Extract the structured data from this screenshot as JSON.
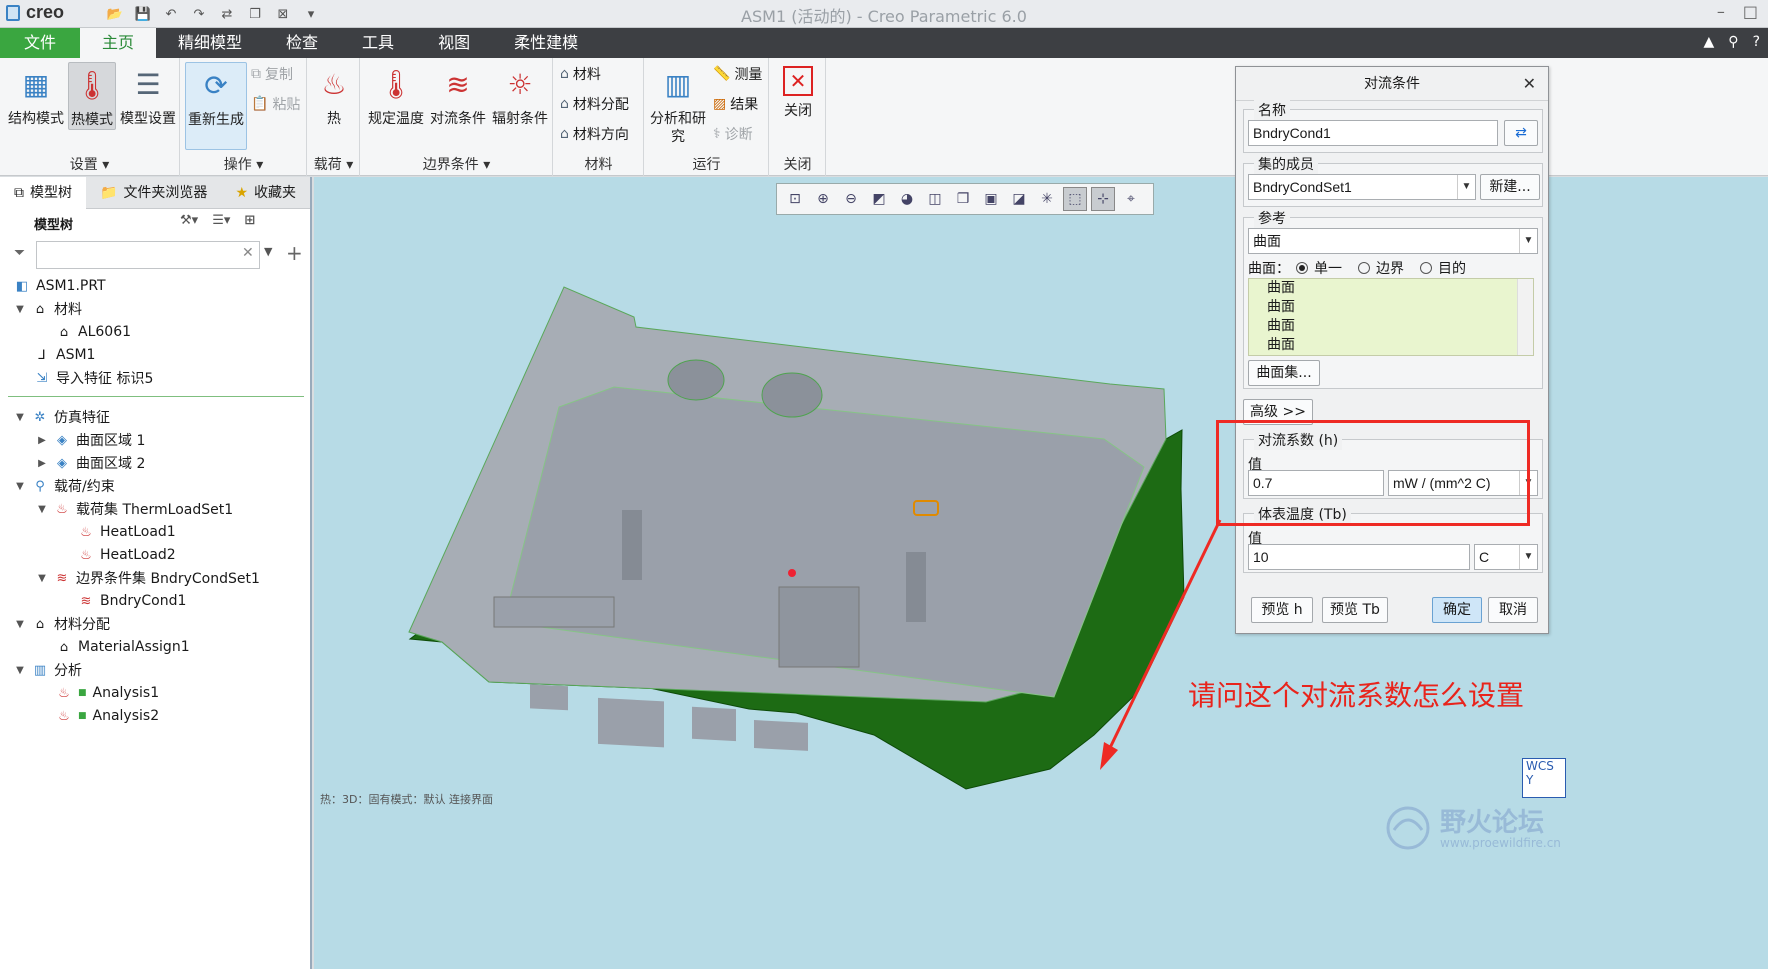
{
  "app": {
    "logo": "creo",
    "window_title": "ASM1 (活动的) - Creo Parametric 6.0"
  },
  "tabs": [
    "文件",
    "主页",
    "精细模型",
    "检查",
    "工具",
    "视图",
    "柔性建模"
  ],
  "ribbon": {
    "groups": {
      "setup": "设置 ▾",
      "operations": "操作 ▾",
      "loads": "载荷 ▾",
      "bc": "边界条件 ▾",
      "material": "材料",
      "run": "运行",
      "close": "关闭"
    },
    "buttons": {
      "structure_mode": "结构模式",
      "thermal_mode": "热模式",
      "model_setup": "模型设置",
      "regenerate": "重新生成",
      "copy": "复制",
      "paste": "粘贴",
      "heat": "热",
      "prescribed_temp": "规定温度",
      "convection": "对流条件",
      "radiation": "辐射条件",
      "materials": "材料",
      "material_assign": "材料分配",
      "material_orient": "材料方向",
      "analysis": "分析和研究",
      "measure": "测量",
      "results": "结果",
      "diagnostics": "诊断",
      "close": "关闭"
    }
  },
  "left_panel": {
    "tabs": [
      "模型树",
      "文件夹浏览器",
      "收藏夹"
    ],
    "tree_header": "模型树",
    "tree": [
      {
        "label": "ASM1.PRT",
        "icon": "part-icon"
      },
      {
        "label": "材料",
        "icon": "material-icon"
      },
      {
        "label": "AL6061",
        "icon": "material-icon"
      },
      {
        "label": "ASM1",
        "icon": "csys-icon"
      },
      {
        "label": "导入特征 标识5",
        "icon": "import-icon"
      },
      {
        "label": "仿真特征",
        "icon": "sim-icon"
      },
      {
        "label": "曲面区域 1",
        "icon": "surface-region-icon"
      },
      {
        "label": "曲面区域 2",
        "icon": "surface-region-icon"
      },
      {
        "label": "载荷/约束",
        "icon": "load-icon"
      },
      {
        "label": "载荷集 ThermLoadSet1",
        "icon": "loadset-icon"
      },
      {
        "label": "HeatLoad1",
        "icon": "heatload-icon"
      },
      {
        "label": "HeatLoad2",
        "icon": "heatload-icon"
      },
      {
        "label": "边界条件集 BndryCondSet1",
        "icon": "bcset-icon"
      },
      {
        "label": "BndryCond1",
        "icon": "convection-icon"
      },
      {
        "label": "材料分配",
        "icon": "material-assign-icon"
      },
      {
        "label": "MaterialAssign1",
        "icon": "material-assign-icon"
      },
      {
        "label": "分析",
        "icon": "analysis-icon"
      },
      {
        "label": "Analysis1",
        "icon": "heatload-icon"
      },
      {
        "label": "Analysis2",
        "icon": "heatload-icon"
      }
    ]
  },
  "viewport": {
    "status": "热：3D：固有模式：默认 连接界面"
  },
  "dialog": {
    "title": "对流条件",
    "name_label": "名称",
    "name_value": "BndryCond1",
    "set_label": "集的成员",
    "set_value": "BndryCondSet1",
    "new_button": "新建...",
    "ref_label": "参考",
    "ref_type": "曲面",
    "surface_label": "曲面：",
    "radio_single": "单一",
    "radio_boundary": "边界",
    "radio_intent": "目的",
    "ref_list": [
      "曲面",
      "曲面",
      "曲面",
      "曲面"
    ],
    "surface_sets_button": "曲面集...",
    "advanced_button": "高级 >>",
    "h_label": "对流系数 (h)",
    "h_value_label": "值",
    "h_value": "0.7",
    "h_unit": "mW / (mm^2 C)",
    "tb_label": "体表温度 (Tb)",
    "tb_value_label": "值",
    "tb_value": "10",
    "tb_unit": "C",
    "preview_h": "预览 h",
    "preview_tb": "预览 Tb",
    "ok": "确定",
    "cancel": "取消"
  },
  "annotation": "请问这个对流系数怎么设置",
  "wcs": {
    "label": "WCS",
    "axis": "Y"
  },
  "watermark": {
    "title": "野火论坛",
    "url": "www.proewildfire.cn"
  },
  "colors": {
    "accent_green": "#3aa640",
    "highlight_red": "#ee2a24",
    "viewport_bg": "#b7dbe6",
    "model_green": "#1d6b14"
  }
}
